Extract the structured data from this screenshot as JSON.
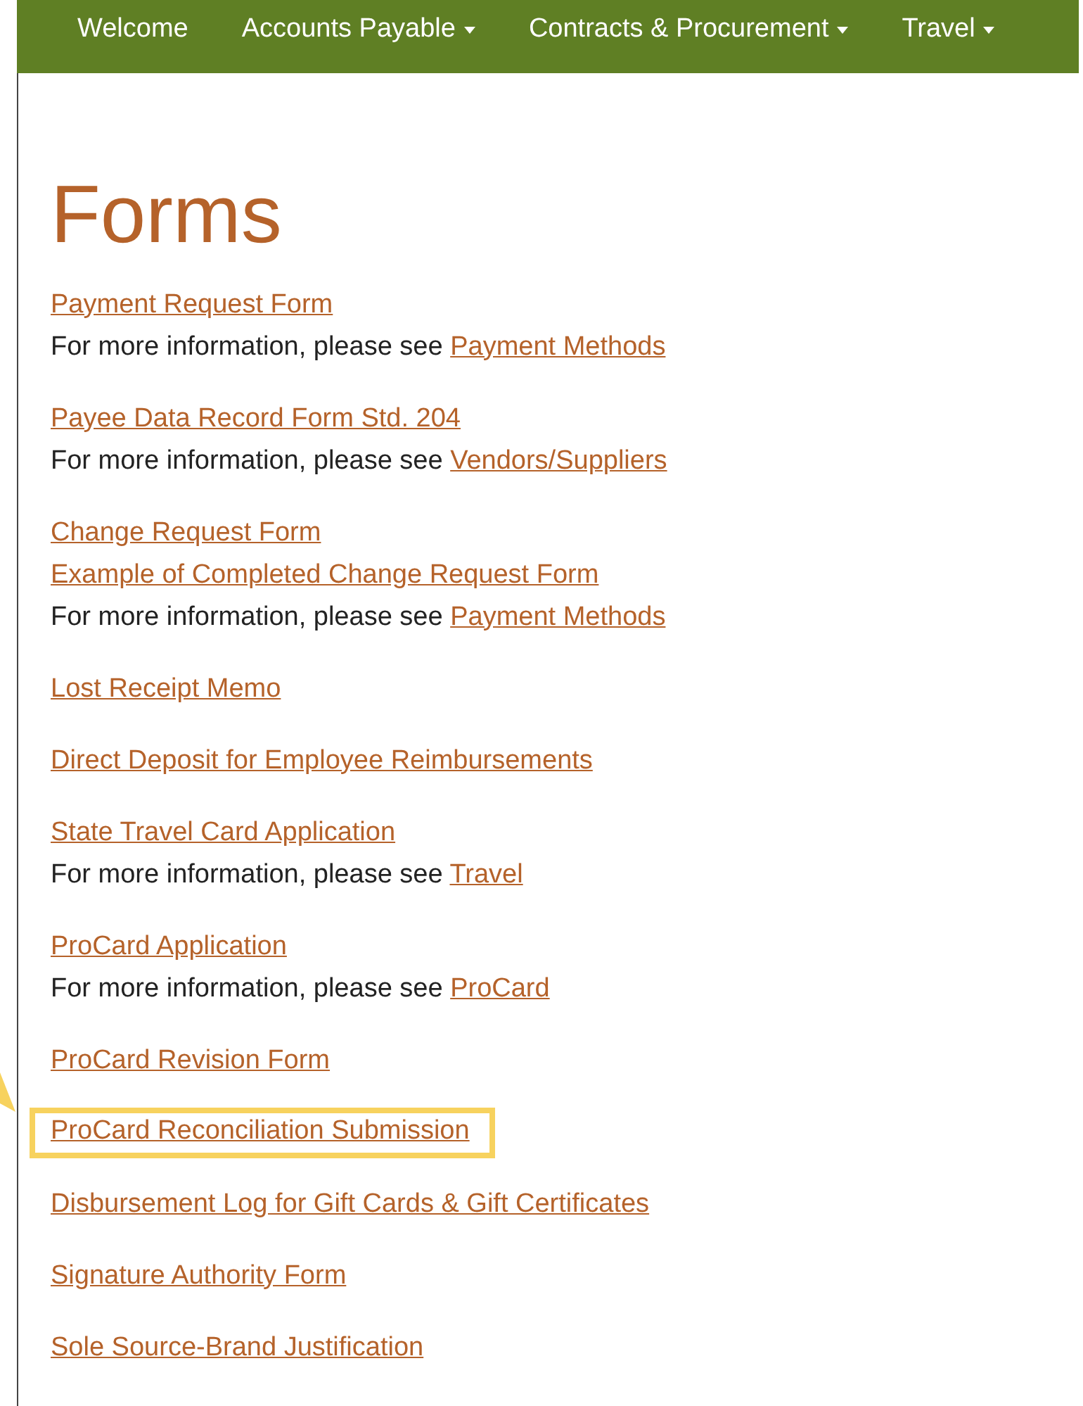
{
  "nav": [
    {
      "label": "Welcome",
      "dropdown": false
    },
    {
      "label": "Accounts Payable",
      "dropdown": true
    },
    {
      "label": "Contracts & Procurement",
      "dropdown": true
    },
    {
      "label": "Travel",
      "dropdown": true
    }
  ],
  "title": "Forms",
  "groups": [
    {
      "lines": [
        {
          "kind": "link",
          "text": "Payment Request Form",
          "highlighted": false
        },
        {
          "kind": "info",
          "prefix": "For more information, please see",
          "link": "Payment Methods"
        }
      ]
    },
    {
      "lines": [
        {
          "kind": "link",
          "text": "Payee Data Record Form Std. 204",
          "highlighted": false
        },
        {
          "kind": "info",
          "prefix": "For more information, please see",
          "link": "Vendors/Suppliers"
        }
      ]
    },
    {
      "lines": [
        {
          "kind": "link",
          "text": "Change Request Form",
          "highlighted": false
        },
        {
          "kind": "link",
          "text": "Example of Completed Change Request Form",
          "highlighted": false
        },
        {
          "kind": "info",
          "prefix": "For more information, please see",
          "link": "Payment Methods"
        }
      ]
    },
    {
      "lines": [
        {
          "kind": "link",
          "text": "Lost Receipt Memo",
          "highlighted": false
        }
      ]
    },
    {
      "lines": [
        {
          "kind": "link",
          "text": "Direct Deposit for Employee Reimbursements",
          "highlighted": false
        }
      ]
    },
    {
      "lines": [
        {
          "kind": "link",
          "text": "State Travel Card Application",
          "highlighted": false
        },
        {
          "kind": "info",
          "prefix": "For more information, please see",
          "link": "Travel"
        }
      ]
    },
    {
      "lines": [
        {
          "kind": "link",
          "text": "ProCard Application",
          "highlighted": false
        },
        {
          "kind": "info",
          "prefix": "For more information, please see",
          "link": "ProCard"
        }
      ]
    },
    {
      "lines": [
        {
          "kind": "link",
          "text": "ProCard Revision Form",
          "highlighted": false
        }
      ]
    },
    {
      "lines": [
        {
          "kind": "link",
          "text": "ProCard Reconciliation Submission",
          "highlighted": true
        }
      ]
    },
    {
      "lines": [
        {
          "kind": "link",
          "text": "Disbursement Log for Gift Cards & Gift Certificates",
          "highlighted": false
        }
      ]
    },
    {
      "lines": [
        {
          "kind": "link",
          "text": "Signature Authority Form",
          "highlighted": false
        }
      ]
    },
    {
      "lines": [
        {
          "kind": "link",
          "text": "Sole Source-Brand Justification",
          "highlighted": false
        }
      ]
    }
  ]
}
